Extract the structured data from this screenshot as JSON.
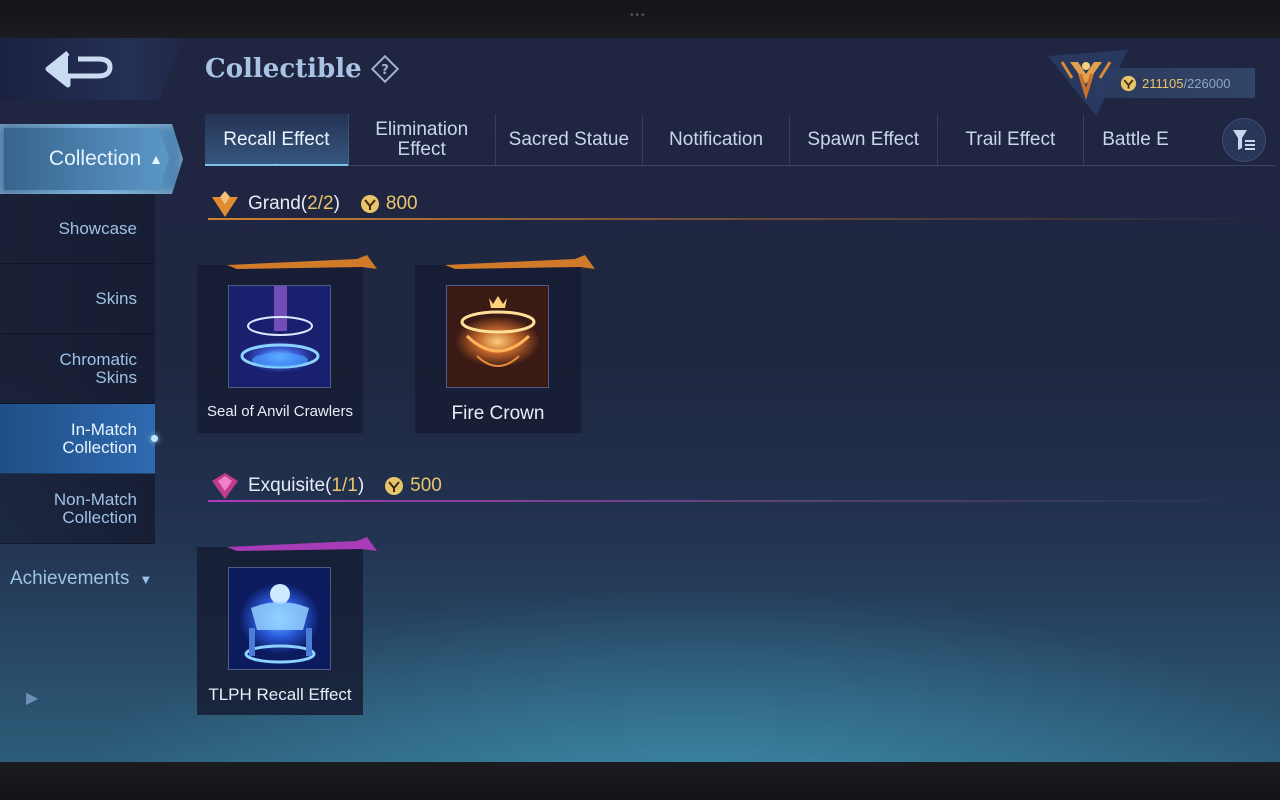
{
  "header": {
    "title": "Collectible",
    "currency": {
      "current": "211105",
      "max": "/226000"
    }
  },
  "sidebar": {
    "collection_label": "Collection",
    "items": [
      {
        "label": "Showcase"
      },
      {
        "label": "Skins"
      },
      {
        "label": "Chromatic\nSkins"
      },
      {
        "label": "In-Match\nCollection"
      },
      {
        "label": "Non-Match\nCollection"
      }
    ],
    "achievements_label": "Achievements"
  },
  "tabs": [
    {
      "label": "Recall Effect"
    },
    {
      "label": "Elimination\nEffect"
    },
    {
      "label": "Sacred Statue"
    },
    {
      "label": "Notification"
    },
    {
      "label": "Spawn Effect"
    },
    {
      "label": "Trail Effect"
    },
    {
      "label": "Battle E"
    }
  ],
  "sections": [
    {
      "name": "Grand(",
      "count": "2/2",
      "close": ")",
      "price": "800",
      "items": [
        {
          "name": "Seal of Anvil Crawlers"
        },
        {
          "name": "Fire Crown"
        }
      ]
    },
    {
      "name": "Exquisite(",
      "count": "1/1",
      "close": ")",
      "price": "500",
      "items": [
        {
          "name": "TLPH Recall Effect"
        }
      ]
    }
  ],
  "colors": {
    "grand_accent": "#e28c32",
    "exquisite_accent": "#be3cc8",
    "gold_text": "#e9c56b",
    "active_tab": "#7cc6ef"
  }
}
